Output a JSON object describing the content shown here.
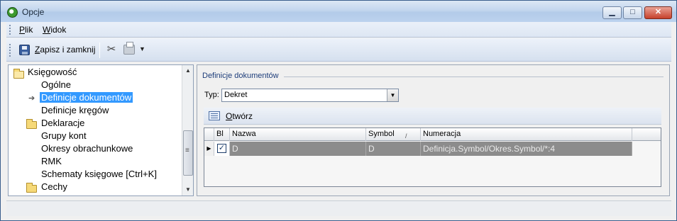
{
  "window": {
    "title": "Opcje",
    "minimize": "▁",
    "maximize": "□",
    "close": "✕"
  },
  "menu": {
    "plik": {
      "underline": "P",
      "rest": "lik"
    },
    "widok": {
      "underline": "W",
      "rest": "idok"
    }
  },
  "toolbar": {
    "save": {
      "underline": "Z",
      "rest": "apisz i zamknij",
      "icon": "save-icon"
    },
    "tools_icon": "tools-icon",
    "print_icon": "printer-icon",
    "tools_glyph": "✂",
    "dropdown_glyph": "▼"
  },
  "tree": {
    "items": [
      {
        "label": "Księgowość",
        "type": "folder-open"
      },
      {
        "label": "Ogólne",
        "type": "leaf"
      },
      {
        "label": "Definicje dokumentów",
        "type": "leaf",
        "selected": true
      },
      {
        "label": "Definicje kręgów",
        "type": "leaf"
      },
      {
        "label": "Deklaracje",
        "type": "folder"
      },
      {
        "label": "Grupy kont",
        "type": "leaf"
      },
      {
        "label": "Okresy obrachunkowe",
        "type": "leaf"
      },
      {
        "label": "RMK",
        "type": "leaf"
      },
      {
        "label": "Schematy księgowe [Ctrl+K]",
        "type": "leaf"
      },
      {
        "label": "Cechy",
        "type": "folder"
      }
    ],
    "marker": "➔",
    "scroll_up": "▲",
    "scroll_down": "▼"
  },
  "group": {
    "title": "Definicje dokumentów"
  },
  "typ": {
    "label": "Typ:",
    "value": "Dekret",
    "dropdown": "▼"
  },
  "sub_toolbar": {
    "open_underline": "O",
    "open_rest": "twórz"
  },
  "grid": {
    "columns": {
      "bl": "Bl",
      "nazwa": "Nazwa",
      "symbol": "Symbol",
      "numeracja": "Numeracja"
    },
    "sort_indicator": "/",
    "rows": [
      {
        "indicator": "▶",
        "checked": "✓",
        "nazwa": "D",
        "symbol": "D",
        "numeracja": "Definicja.Symbol/Okres.Symbol/*:4"
      }
    ]
  }
}
